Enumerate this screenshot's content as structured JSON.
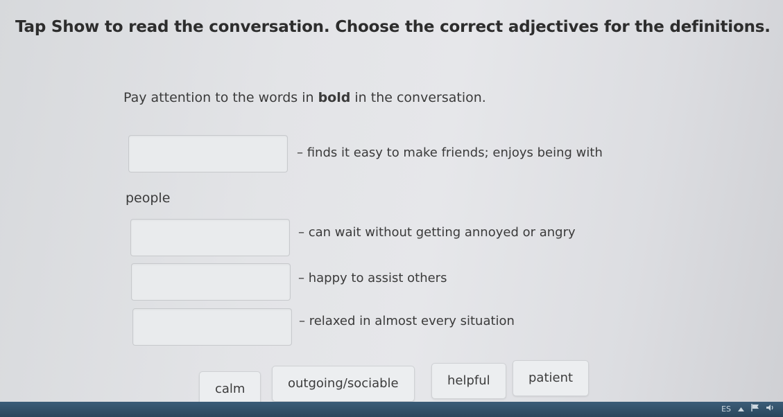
{
  "instruction": {
    "prefix": "Tap ",
    "bold_word": "Show",
    "suffix": " to read the conversation. Choose the correct adjectives for the definitions."
  },
  "note": {
    "prefix": "Pay attention to the words in ",
    "bold_word": "bold",
    "suffix": " in the conversation."
  },
  "definitions": [
    {
      "text": "– finds it easy to make friends; enjoys being with",
      "continuation": "people"
    },
    {
      "text": "– can wait without getting annoyed or angry"
    },
    {
      "text": "– happy to assist others"
    },
    {
      "text": "– relaxed in almost every situation"
    }
  ],
  "options": [
    "calm",
    "outgoing/sociable",
    "helpful",
    "patient"
  ],
  "taskbar": {
    "language": "ES",
    "tray_icons": [
      "chevron-up-icon",
      "flag-icon",
      "volume-icon"
    ]
  }
}
